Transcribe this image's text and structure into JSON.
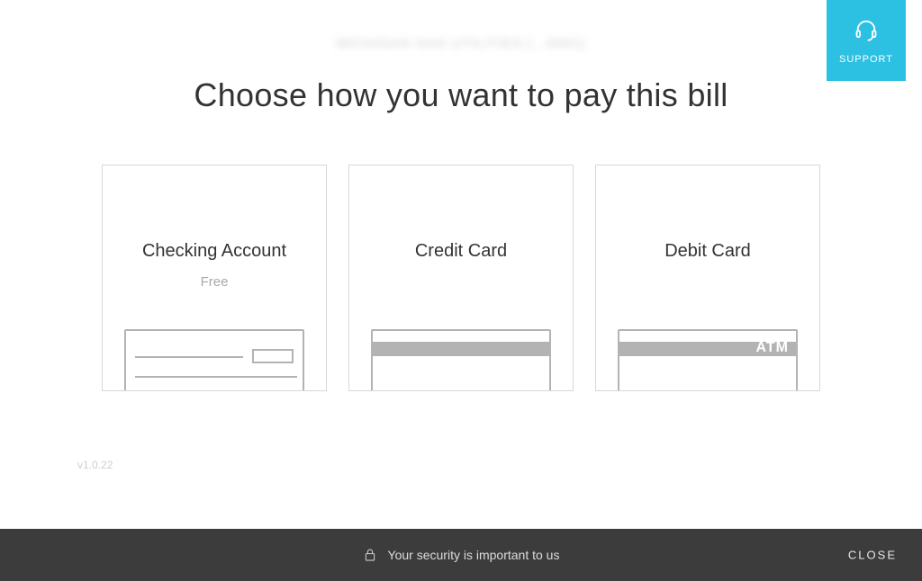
{
  "support": {
    "label": "SUPPORT"
  },
  "header": {
    "company": "MICHIGAN GAS UTILITIES (...0001)",
    "title": "Choose how you want to pay this bill"
  },
  "options": [
    {
      "name": "Checking Account",
      "sub": "Free",
      "type": "check"
    },
    {
      "name": "Credit Card",
      "sub": "",
      "type": "credit"
    },
    {
      "name": "Debit Card",
      "sub": "",
      "type": "debit",
      "atm_label": "ATM"
    }
  ],
  "version": "v1.0.22",
  "footer": {
    "security_text": "Your security is important to us",
    "close_label": "CLOSE"
  }
}
